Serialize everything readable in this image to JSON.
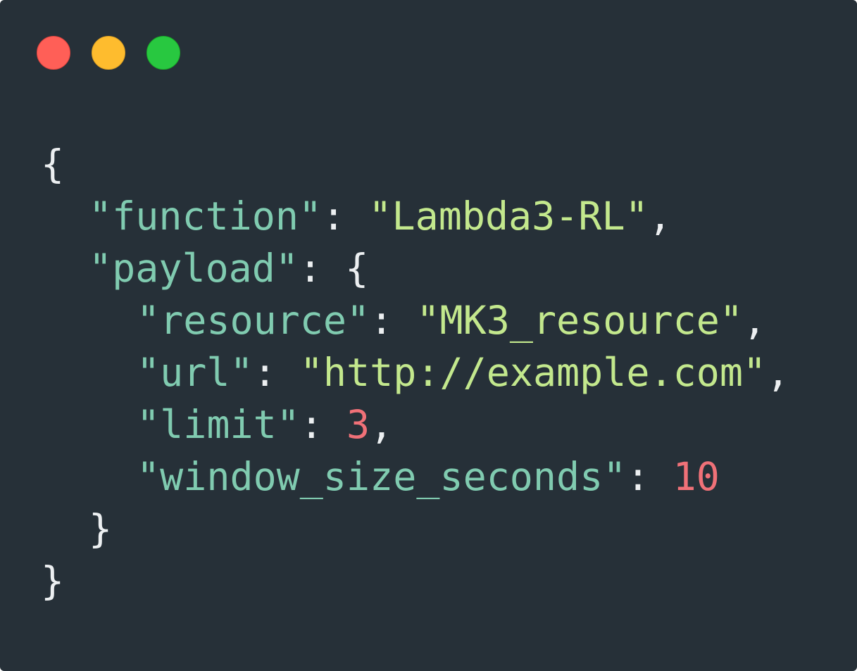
{
  "window": {
    "controls": [
      "close",
      "minimize",
      "maximize"
    ],
    "colors": {
      "background": "#263038",
      "close": "#ff5f57",
      "minimize": "#febc2e",
      "maximize": "#28c840",
      "key": "#80cbb0",
      "string": "#c3e88d",
      "number": "#f07178",
      "punctuation": "#eceff1"
    }
  },
  "code": {
    "open_brace": "{",
    "function_key": "\"function\"",
    "function_value": "\"Lambda3-RL\"",
    "payload_key": "\"payload\"",
    "payload_open": "{",
    "resource_key": "\"resource\"",
    "resource_value": "\"MK3_resource\"",
    "url_key": "\"url\"",
    "url_value": "\"http://example.com\"",
    "limit_key": "\"limit\"",
    "limit_value": "3",
    "window_key": "\"window_size_seconds\"",
    "window_value": "10",
    "payload_close": "}",
    "close_brace": "}",
    "colon": ": ",
    "comma": ","
  }
}
